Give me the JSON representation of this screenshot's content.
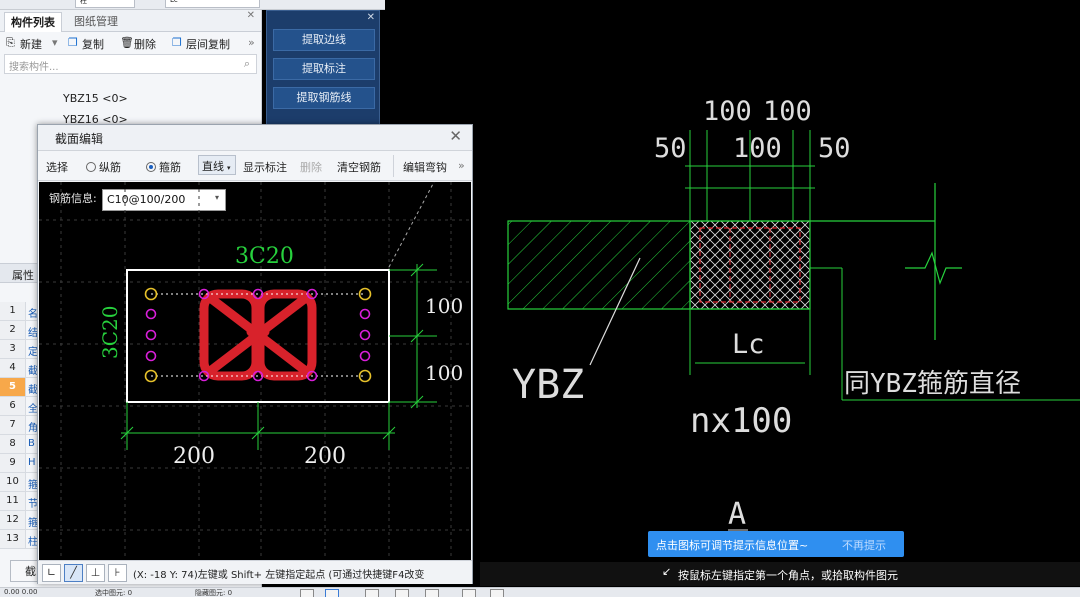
{
  "top": {
    "label_a": "柱",
    "label_b": "Lc"
  },
  "left_panel": {
    "tab_active": "构件列表",
    "tab_inactive": "图纸管理",
    "toolbar": {
      "new": "新建",
      "copy": "复制",
      "delete": "删除",
      "floor_copy": "层间复制",
      "more": "»"
    },
    "search_placeholder": "搜索构件...",
    "items": [
      "YBZ15 <0>",
      "YBZ16 <0>"
    ],
    "props_title": "属性",
    "rows": [
      {
        "n": "1",
        "t": "名"
      },
      {
        "n": "2",
        "t": "结"
      },
      {
        "n": "3",
        "t": "定"
      },
      {
        "n": "4",
        "t": "截"
      },
      {
        "n": "5",
        "t": "截"
      },
      {
        "n": "6",
        "t": "全"
      },
      {
        "n": "7",
        "t": "角"
      },
      {
        "n": "8",
        "t": "B"
      },
      {
        "n": "9",
        "t": "H"
      },
      {
        "n": "10",
        "t": "箍"
      },
      {
        "n": "11",
        "t": "节"
      },
      {
        "n": "12",
        "t": "箍"
      },
      {
        "n": "13",
        "t": "柱"
      }
    ],
    "selected_row": "5",
    "bottom_button": "截"
  },
  "blue_panel": {
    "buttons": [
      "提取边线",
      "提取标注",
      "提取钢筋线"
    ]
  },
  "dialog": {
    "title": "截面编辑",
    "toolbar": {
      "select": "选择",
      "longitudinal": "纵筋",
      "stirrup": "箍筋",
      "line_mode": "直线",
      "show_dim": "显示标注",
      "delete": "删除",
      "clear": "清空钢筋",
      "edit_hook": "编辑弯钩",
      "more": "»"
    },
    "rebar_label": "钢筋信息:",
    "rebar_value": "C10@100/200",
    "drawing": {
      "top_label": "3C20",
      "side_label": "3C20",
      "dim_right_1": "100",
      "dim_right_2": "100",
      "dim_bottom_1": "200",
      "dim_bottom_2": "200"
    },
    "status_text": "(X: -18 Y: 74)左键或 Shift+ 左键指定起点 (可通过快捷键F4改变"
  },
  "cad": {
    "dim_top_1": "100",
    "dim_top_2": "100",
    "dim_mid_left": "50",
    "dim_mid_center": "100",
    "dim_mid_right": "50",
    "label_ybz": "YBZ",
    "label_lc": "Lc",
    "label_nx": "nx100",
    "label_same": "同YBZ箍筋直径",
    "label_a": "A"
  },
  "tip": {
    "text": "点击图标可调节提示信息位置~",
    "dismiss": "不再提示"
  },
  "hint": {
    "text": "按鼠标左键指定第一个角点，或拾取构件图元"
  },
  "bottom": {
    "text_a": "0.00  0.00",
    "text_b": "选中图元: 0",
    "text_c": "隐藏图元: 0"
  },
  "colors": {
    "cad_green": "#27d13d",
    "rebar_red": "#d8222b",
    "dot_yellow": "#e6c12a",
    "dot_magenta": "#d81fd8",
    "tip_blue": "#2f8ff0"
  }
}
